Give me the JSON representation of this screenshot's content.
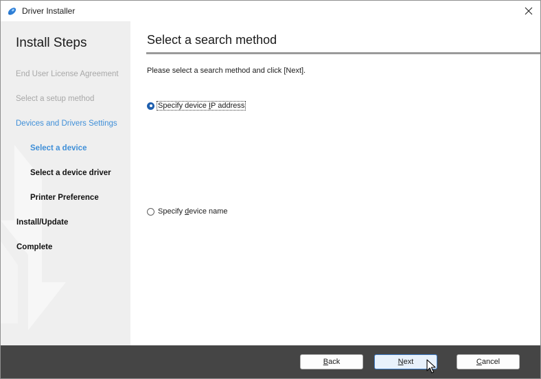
{
  "window": {
    "title": "Driver Installer",
    "icon": "rocket-icon"
  },
  "sidebar": {
    "title": "Install Steps",
    "steps": [
      {
        "label": "End User License Agreement",
        "state": "done"
      },
      {
        "label": "Select a setup method",
        "state": "done"
      },
      {
        "label": "Devices and Drivers Settings",
        "state": "active"
      },
      {
        "label": "Select a device",
        "state": "current-substep"
      },
      {
        "label": "Select a device driver",
        "state": "pending-substep"
      },
      {
        "label": "Printer Preference",
        "state": "pending-substep"
      },
      {
        "label": "Install/Update",
        "state": "pending"
      },
      {
        "label": "Complete",
        "state": "pending"
      }
    ]
  },
  "main": {
    "title": "Select a search method",
    "instruction": "Please select a search method and click [Next].",
    "options": [
      {
        "before": "Specify device ",
        "accel": "I",
        "after": "P address",
        "checked": true
      },
      {
        "before": "Specify ",
        "accel": "d",
        "after": "evice name",
        "checked": false
      }
    ]
  },
  "footer": {
    "back": {
      "accel": "B",
      "rest": "ack"
    },
    "next": {
      "accel": "N",
      "rest": "ext"
    },
    "cancel": {
      "accel": "C",
      "rest": "ancel"
    }
  },
  "colors": {
    "accent": "#3f8fd8",
    "radio_selected": "#1f5fae",
    "footer_bg": "#454545",
    "sidebar_bg": "#efefef"
  }
}
